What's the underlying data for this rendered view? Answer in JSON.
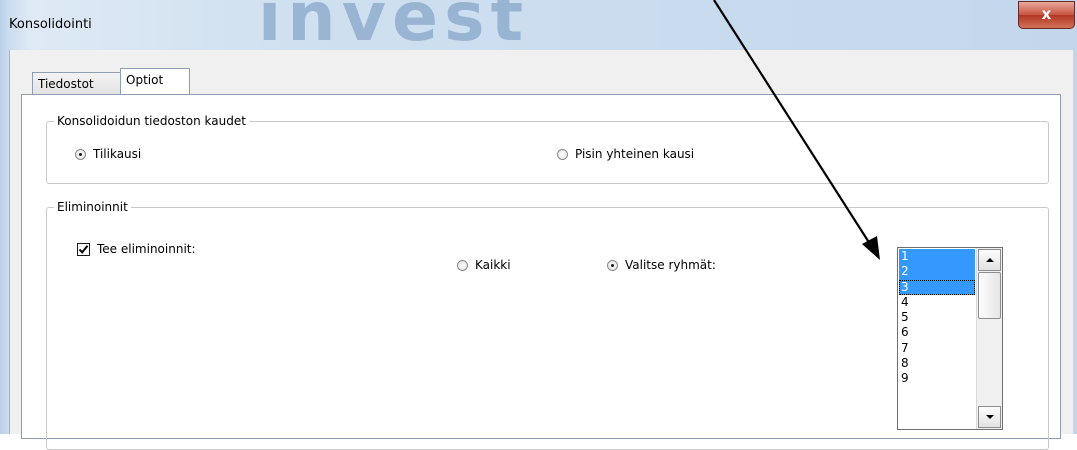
{
  "window": {
    "title": "Konsolidointi",
    "watermark": "invest",
    "close_label": "x"
  },
  "tabs": [
    {
      "label": "Tiedostot",
      "active": false
    },
    {
      "label": "Optiot",
      "active": true
    }
  ],
  "period_group": {
    "legend": "Konsolidoidun tiedoston kaudet",
    "options": [
      {
        "label": "Tilikausi",
        "checked": true
      },
      {
        "label": "Pisin yhteinen kausi",
        "checked": false
      }
    ]
  },
  "elimination_group": {
    "legend": "Eliminoinnit",
    "checkbox": {
      "label": "Tee eliminoinnit:",
      "checked": true
    },
    "options": [
      {
        "label": "Kaikki",
        "checked": false
      },
      {
        "label": "Valitse ryhmät:",
        "checked": true
      }
    ],
    "group_list": {
      "items": [
        "1",
        "2",
        "3",
        "4",
        "5",
        "6",
        "7",
        "8",
        "9"
      ],
      "selected": [
        "1",
        "2",
        "3"
      ],
      "focused": "3"
    }
  },
  "colors": {
    "selection": "#3399ff",
    "close_button": "#c8533f",
    "annotation_arrow": "#000000"
  }
}
